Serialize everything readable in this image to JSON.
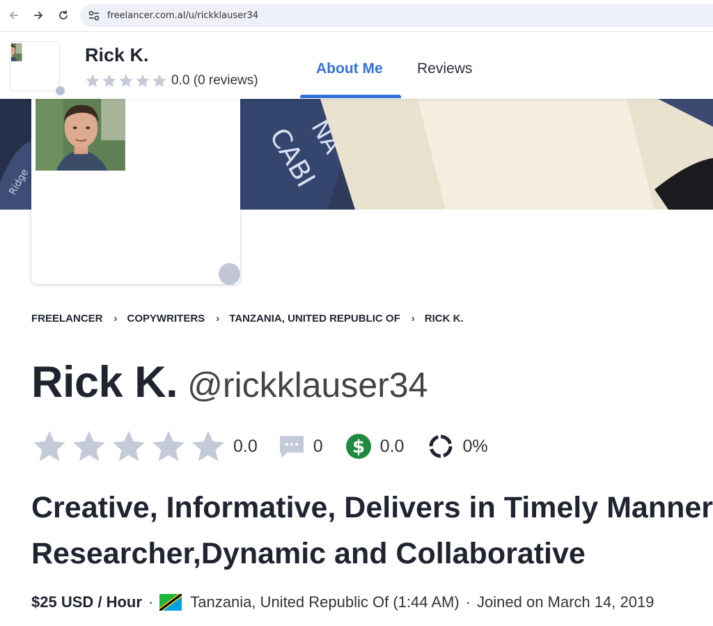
{
  "browser": {
    "url": "freelancer.com.al/u/rickklauser34",
    "back_icon": "arrow-left-icon",
    "forward_icon": "arrow-right-icon",
    "reload_icon": "reload-icon"
  },
  "header": {
    "name": "Rick K.",
    "rating_value": 0.0,
    "rating_text": "0.0 (0 reviews)",
    "tabs": [
      {
        "label": "About Me",
        "active": true
      },
      {
        "label": "Reviews",
        "active": false
      }
    ]
  },
  "breadcrumb": [
    "FREELANCER",
    "COPYWRITERS",
    "TANZANIA, UNITED REPUBLIC OF",
    "RICK K."
  ],
  "profile": {
    "display_name": "Rick K.",
    "username": "@rickklauser34",
    "rating": "0.0",
    "reviews_count": "0",
    "earnings_score": "0.0",
    "completion_rate": "0%",
    "tagline": "Creative, Informative, Delivers in Timely Manner, Researcher,Dynamic and Collaborative",
    "hourly_rate": "$25 USD / Hour",
    "location": "Tanzania, United Republic Of (1:44 AM)",
    "joined": "Joined on March 14, 2019"
  },
  "colors": {
    "accent": "#3272d8",
    "star_empty": "#c4cad8",
    "earnings_green": "#1f8a3f",
    "text_dark": "#1f2430"
  }
}
